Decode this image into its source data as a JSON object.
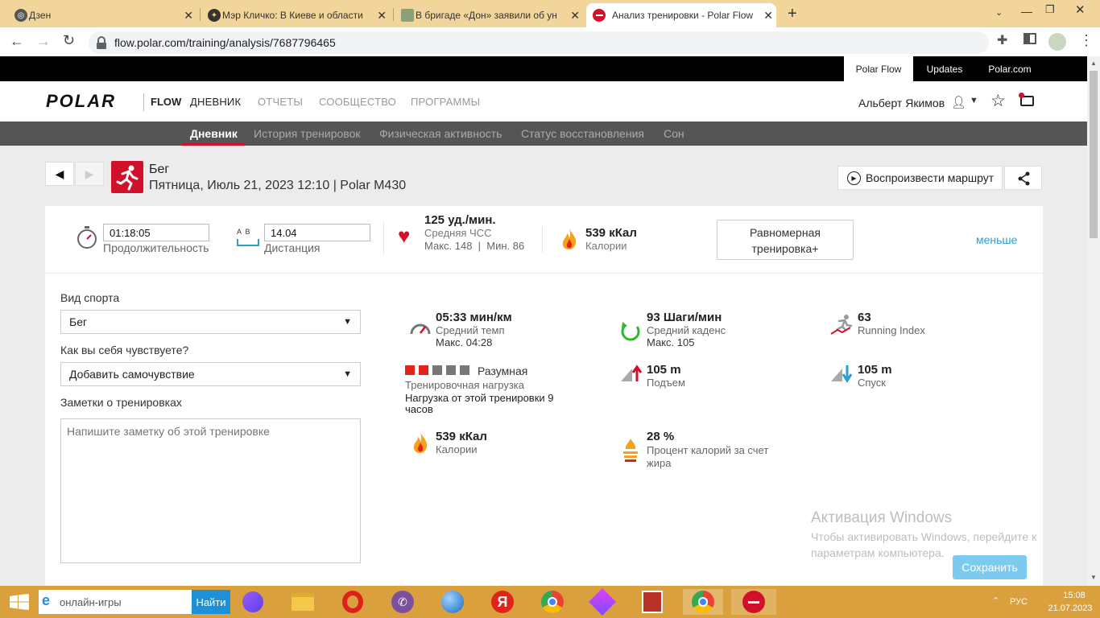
{
  "browser": {
    "tabs": [
      {
        "title": "Дзен"
      },
      {
        "title": "Мэр Кличко: В Киеве и области"
      },
      {
        "title": "В бригаде «Дон» заявили об ун"
      },
      {
        "title": "Анализ тренировки - Polar Flow"
      }
    ],
    "url": "flow.polar.com/training/analysis/7687796465"
  },
  "topstrip": {
    "links": [
      "Polar Flow",
      "Updates",
      "Polar.com"
    ]
  },
  "header": {
    "logo": "POLAR",
    "flow": "FLOW",
    "nav": [
      "ДНЕВНИК",
      "ОТЧЕТЫ",
      "СООБЩЕСТВО",
      "ПРОГРАММЫ"
    ],
    "user": "Альберт Якимов"
  },
  "subnav": [
    "Дневник",
    "История тренировок",
    "Физическая активность",
    "Статус восстановления",
    "Сон"
  ],
  "training": {
    "sport": "Бег",
    "datetime": "Пятница, Июль 21, 2023 12:10 | Polar M430",
    "play_route": "Воспроизвести маршрут"
  },
  "summary": {
    "duration": "01:18:05",
    "duration_label": "Продолжительность",
    "distance_ab": "A  B",
    "distance": "14.04",
    "distance_label": "Дистанция",
    "hr": "125 уд./мин.",
    "hr_label": "Средняя ЧСС",
    "hr_minmax": "Макс. 148  |  Мин. 86",
    "calories": "539 кКал",
    "calories_label": "Калории",
    "benefit_line1": "Равномерная",
    "benefit_line2": "тренировка+",
    "less": "меньше"
  },
  "form": {
    "sport_label": "Вид спорта",
    "sport_value": "Бег",
    "feeling_label": "Как вы себя чувствуете?",
    "feeling_value": "Добавить самочувствие",
    "notes_label": "Заметки о тренировках",
    "notes_placeholder": "Напишите заметку об этой тренировке"
  },
  "details": {
    "pace": "05:33 мин/км",
    "pace_label": "Средний темп",
    "pace_max": "Макс. 04:28",
    "cadence": "93 Шаги/мин",
    "cadence_label": "Средний каденс",
    "cadence_max": "Макс. 105",
    "running_index": "63",
    "running_index_label": "Running Index",
    "load_level": "Разумная",
    "load_level_blocks_filled": 2,
    "load_level_blocks_total": 5,
    "load_label": "Тренировочная нагрузка",
    "load_text": "Нагрузка от этой тренировки 9 часов",
    "ascent": "105 m",
    "ascent_label": "Подъем",
    "descent": "105 m",
    "descent_label": "Спуск",
    "calories": "539 кКал",
    "calories_label": "Калории",
    "fat": "28 %",
    "fat_label": "Процент калорий за счет жира"
  },
  "watermark": {
    "title": "Активация Windows",
    "line": "Чтобы активировать Windows, перейдите к параметрам компьютера."
  },
  "save_button": "Сохранить",
  "taskbar": {
    "search_placeholder": "онлайн-игры",
    "search_button": "Найти",
    "lang": "РУС",
    "time": "15:08",
    "date": "21.07.2023"
  },
  "colors": {
    "accent": "#d1112b",
    "link": "#2a9fd6",
    "save": "#7ccaf0",
    "taskbar": "#d9a03d"
  }
}
